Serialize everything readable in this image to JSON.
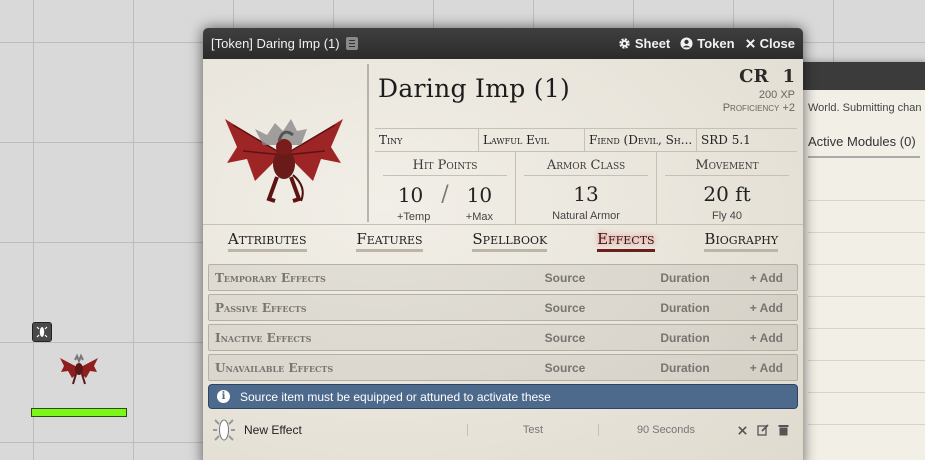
{
  "window": {
    "title": "[Token] Daring Imp (1)",
    "buttons": {
      "sheet": "Sheet",
      "token": "Token",
      "close": "Close"
    }
  },
  "actor": {
    "name": "Daring Imp (1)",
    "cr_label": "CR",
    "cr_value": "1",
    "xp": "200 XP",
    "proficiency": "Proficiency +2",
    "size": "Tiny",
    "alignment": "Lawful Evil",
    "type": "Fiend (Devil, Sh...",
    "source": "SRD 5.1"
  },
  "stats": {
    "hp": {
      "label": "Hit Points",
      "value": "10",
      "max": "10",
      "temp_label": "+Temp",
      "max_label": "+Max"
    },
    "ac": {
      "label": "Armor Class",
      "value": "13",
      "note": "Natural Armor"
    },
    "movement": {
      "label": "Movement",
      "value": "20 ft",
      "note": "Fly 40"
    }
  },
  "tabs": [
    "Attributes",
    "Features",
    "Spellbook",
    "Effects",
    "Biography"
  ],
  "active_tab": "Effects",
  "effect_categories": [
    {
      "name": "Temporary Effects",
      "source": "Source",
      "duration": "Duration",
      "add": "Add"
    },
    {
      "name": "Passive Effects",
      "source": "Source",
      "duration": "Duration",
      "add": "Add"
    },
    {
      "name": "Inactive Effects",
      "source": "Source",
      "duration": "Duration",
      "add": "Add"
    },
    {
      "name": "Unavailable Effects",
      "source": "Source",
      "duration": "Duration",
      "add": "Add"
    }
  ],
  "info_message": "Source item must be equipped or attuned to activate these",
  "effects": [
    {
      "name": "New Effect",
      "source": "Test",
      "duration": "90 Seconds"
    }
  ],
  "background_window": {
    "text": "World. Submitting chan",
    "tab": "Active Modules (0)"
  },
  "colors": {
    "titlebar": "#2f2f2f",
    "sheet_bg": "#ebe7de",
    "info_bar": "#4d6a8c",
    "active_tab_glow": "#ff4a4a",
    "token_bar": "#7cf71a"
  }
}
